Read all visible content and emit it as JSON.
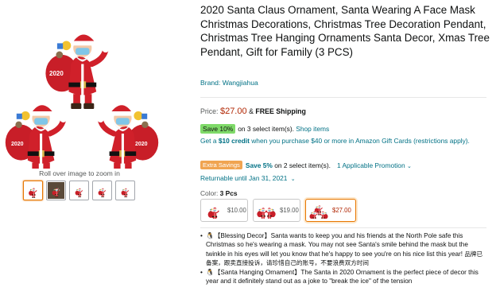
{
  "gallery": {
    "zoom_hint": "Roll over image to zoom in",
    "main_image_icon": "santa-ornament-image",
    "main_image_text": "2020",
    "thumbnails": [
      {
        "name": "thumbnail-1",
        "selected": true
      },
      {
        "name": "thumbnail-2",
        "selected": false
      },
      {
        "name": "thumbnail-3",
        "selected": false
      },
      {
        "name": "thumbnail-4",
        "selected": false
      },
      {
        "name": "thumbnail-5",
        "selected": false
      }
    ]
  },
  "product": {
    "title": "2020 Santa Claus Ornament, Santa Wearing A Face Mask Christmas Decorations, Christmas Tree Decoration Pendant, Christmas Tree Hanging Ornaments Santa Decor, Xmas Tree Pendant, Gift for Family (3 PCS)",
    "brand": "Brand: Wangjiahua"
  },
  "price": {
    "label": "Price:",
    "value": "$27.00",
    "amp": "&",
    "shipping": "FREE Shipping"
  },
  "coupon": {
    "badge": "Save 10%",
    "text": "on 3 select item(s).",
    "link": "Shop items"
  },
  "credit": {
    "prefix": "Get a ",
    "bold": "$10 credit",
    "suffix": " when you purchase $40 or more in Amazon Gift Cards (restrictions apply)."
  },
  "extra_saving": {
    "badge": "Extra Savings",
    "save": "Save 5%",
    "text": "on 2 select item(s).",
    "promo": "1 Applicable Promotion",
    "promo_icon": "chevron-down-icon"
  },
  "returnable": {
    "text": "Returnable until Jan 31, 2021",
    "icon": "chevron-down-icon"
  },
  "color": {
    "label": "Color:",
    "value": "3 Pcs",
    "options": [
      {
        "price": "$10.00",
        "selected": false
      },
      {
        "price": "$19.00",
        "selected": false
      },
      {
        "price": "$27.00",
        "selected": true
      }
    ]
  },
  "bullets": [
    {
      "text": "🐧【Blessing Decor】Santa wants to keep you and his friends at the North Pole safe this Christmas so he's wearing a mask. You may not see Santa's smile behind the mask but the twinkle in his eyes will let you know that he's happy to see you're on his nice list this year! ",
      "cjk": "品牌已备案，跟卖直接投诉，请珍惜自己的账号，不要浪费双方时间"
    },
    {
      "text": "🐧【Santa Hanging Ornament】The Santa in 2020 Ornament is the perfect piece of decor this year and it definitely stand out as a joke to \"break the ice\" of the tension",
      "cjk": ""
    }
  ],
  "colors": {
    "link": "#007185",
    "price": "#b12704",
    "coupon_badge": "#7fda69",
    "extra_badge": "#f0a451",
    "selected_border": "#e77600",
    "santa_red": "#d0202a"
  }
}
